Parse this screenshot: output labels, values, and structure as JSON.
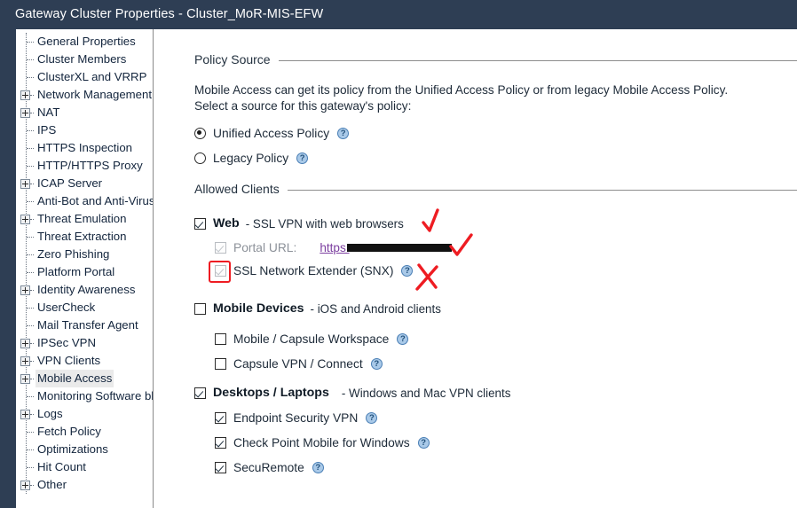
{
  "window": {
    "title": "Gateway Cluster Properties - Cluster_MoR-MIS-EFW",
    "accent_color": "#2e3e54"
  },
  "sidebar": {
    "items": [
      {
        "label": "General Properties",
        "expandable": false,
        "selected": false
      },
      {
        "label": "Cluster Members",
        "expandable": false,
        "selected": false
      },
      {
        "label": "ClusterXL and VRRP",
        "expandable": false,
        "selected": false
      },
      {
        "label": "Network Management",
        "expandable": true,
        "selected": false
      },
      {
        "label": "NAT",
        "expandable": true,
        "selected": false
      },
      {
        "label": "IPS",
        "expandable": false,
        "selected": false
      },
      {
        "label": "HTTPS Inspection",
        "expandable": false,
        "selected": false
      },
      {
        "label": "HTTP/HTTPS Proxy",
        "expandable": false,
        "selected": false
      },
      {
        "label": "ICAP Server",
        "expandable": true,
        "selected": false
      },
      {
        "label": "Anti-Bot and Anti-Virus",
        "expandable": false,
        "selected": false
      },
      {
        "label": "Threat Emulation",
        "expandable": true,
        "selected": false
      },
      {
        "label": "Threat Extraction",
        "expandable": false,
        "selected": false
      },
      {
        "label": "Zero Phishing",
        "expandable": false,
        "selected": false
      },
      {
        "label": "Platform Portal",
        "expandable": false,
        "selected": false
      },
      {
        "label": "Identity Awareness",
        "expandable": true,
        "selected": false
      },
      {
        "label": "UserCheck",
        "expandable": false,
        "selected": false
      },
      {
        "label": "Mail Transfer Agent",
        "expandable": false,
        "selected": false
      },
      {
        "label": "IPSec VPN",
        "expandable": true,
        "selected": false
      },
      {
        "label": "VPN Clients",
        "expandable": true,
        "selected": false
      },
      {
        "label": "Mobile Access",
        "expandable": true,
        "selected": true
      },
      {
        "label": "Monitoring Software blade",
        "expandable": false,
        "selected": false
      },
      {
        "label": "Logs",
        "expandable": true,
        "selected": false
      },
      {
        "label": "Fetch Policy",
        "expandable": false,
        "selected": false
      },
      {
        "label": "Optimizations",
        "expandable": false,
        "selected": false
      },
      {
        "label": "Hit Count",
        "expandable": false,
        "selected": false
      },
      {
        "label": "Other",
        "expandable": true,
        "selected": false
      }
    ]
  },
  "policy_source": {
    "group_title": "Policy Source",
    "description_line1": "Mobile Access can get its policy from the Unified Access Policy or from legacy Mobile Access Policy.",
    "description_line2": "Select a source for this gateway's policy:",
    "options": [
      {
        "label": "Unified Access Policy",
        "selected": true,
        "help": "?"
      },
      {
        "label": "Legacy Policy",
        "selected": false,
        "help": "?"
      }
    ]
  },
  "allowed_clients": {
    "group_title": "Allowed Clients",
    "web": {
      "label": "Web",
      "suffix": "- SSL VPN with web browsers",
      "checked": true,
      "portal_url": {
        "label": "Portal URL:",
        "value": "https:",
        "checked": true,
        "disabled": true
      },
      "snx": {
        "label": "SSL Network Extender (SNX)",
        "checked": true,
        "disabled": true,
        "help": "?",
        "highlighted": true
      }
    },
    "mobile_devices": {
      "label": "Mobile Devices",
      "suffix": "- iOS and Android clients",
      "checked": false,
      "children": [
        {
          "label": "Mobile / Capsule Workspace",
          "checked": false,
          "help": "?"
        },
        {
          "label": "Capsule VPN / Connect",
          "checked": false,
          "help": "?"
        }
      ]
    },
    "desktops": {
      "label": "Desktops / Laptops",
      "suffix": "- Windows and Mac VPN clients",
      "checked": true,
      "children": [
        {
          "label": "Endpoint Security VPN",
          "checked": true,
          "help": "?"
        },
        {
          "label": "Check Point Mobile for Windows",
          "checked": true,
          "help": "?"
        },
        {
          "label": "SecuRemote",
          "checked": true,
          "help": "?"
        }
      ]
    }
  },
  "annotations": {
    "color": "#ee1c22",
    "marks": [
      {
        "type": "check",
        "target": "web-row"
      },
      {
        "type": "check",
        "target": "portal-url-row"
      },
      {
        "type": "cross",
        "target": "snx-row"
      },
      {
        "type": "box",
        "target": "snx-checkbox"
      }
    ]
  }
}
